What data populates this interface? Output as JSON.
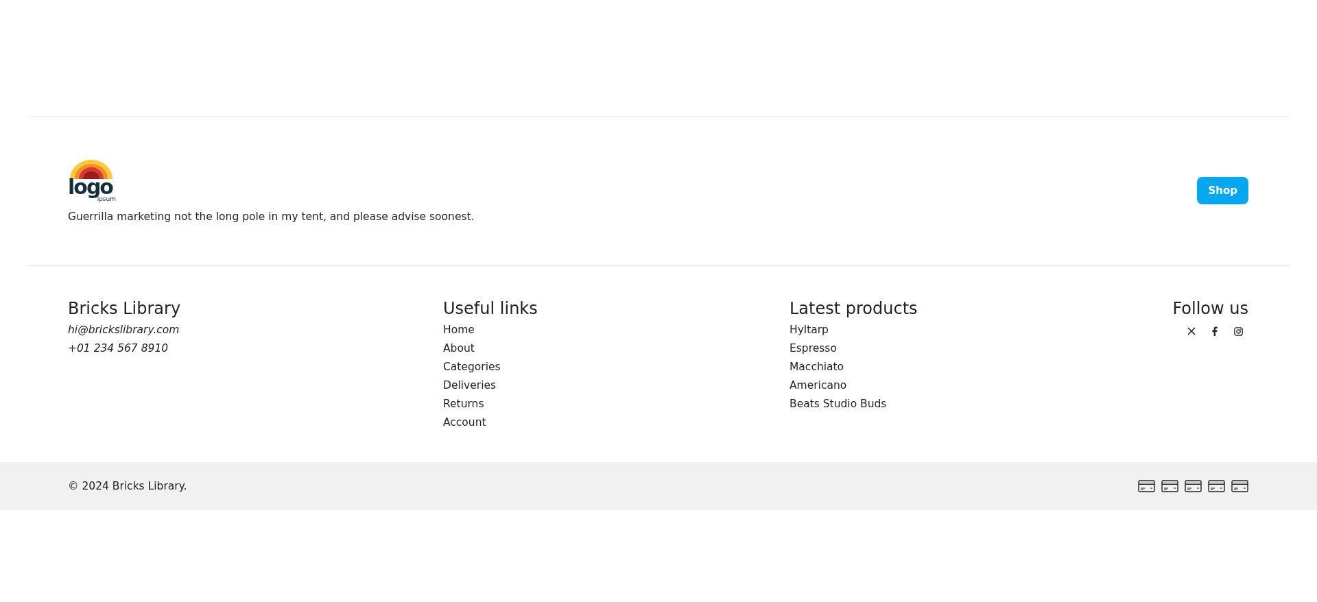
{
  "brand": {
    "logo_word": "logo",
    "logo_tagline": "ipsum",
    "tagline": "Guerrilla marketing not the long pole in my tent, and please advise soonest.",
    "cta": "Shop"
  },
  "columns": [
    {
      "kind": "contact",
      "title": "Bricks Library",
      "items": [
        "hi@brickslibrary.com",
        "+01 234 567 8910"
      ]
    },
    {
      "kind": "links",
      "title": "Useful links",
      "items": [
        "Home",
        "About",
        "Categories",
        "Deliveries",
        "Returns",
        "Account"
      ]
    },
    {
      "kind": "links",
      "title": "Latest products",
      "items": [
        "Hyltarp",
        "Espresso",
        "Macchiato",
        "Americano",
        "Beats Studio Buds"
      ]
    },
    {
      "kind": "social",
      "title": "Follow us",
      "items": [
        {
          "kind": "x"
        },
        {
          "kind": "facebook"
        },
        {
          "kind": "instagram"
        }
      ]
    }
  ],
  "bottom_bar": {
    "copyright": "© 2024 Bricks Library.",
    "payment_icons": [
      {
        "kind": "card"
      },
      {
        "kind": "card"
      },
      {
        "kind": "card"
      },
      {
        "kind": "card"
      },
      {
        "kind": "card"
      }
    ]
  }
}
